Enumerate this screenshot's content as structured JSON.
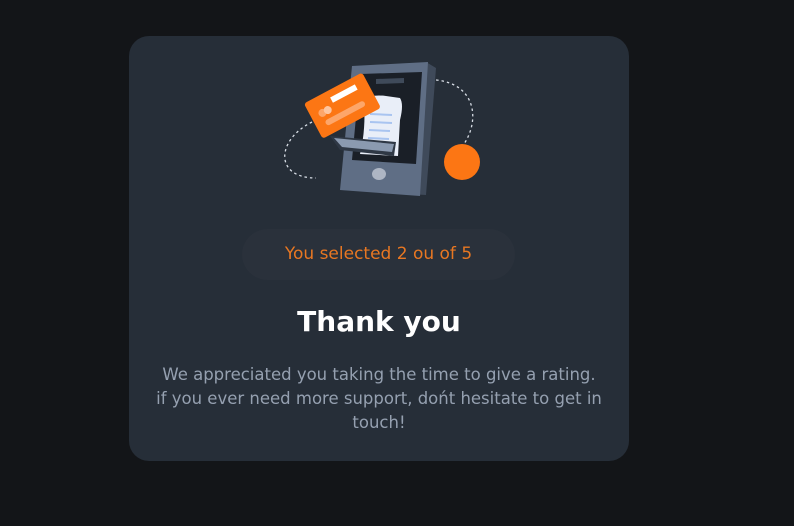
{
  "card": {
    "selection_text": "You selected 2 ou of 5",
    "title": "Thank you",
    "message_lines": [
      "We appreciated you taking the time to give a rating.",
      "if you ever need more support, dońt hesitate to get in",
      "touch!"
    ]
  },
  "colors": {
    "page_bg": "#131518",
    "card_bg": "#262E38",
    "accent_orange": "#FC7614",
    "pill_text": "#E87722",
    "title": "#FFFFFF",
    "body_text": "#95A0B0"
  },
  "icons": {
    "illustration": "phone-with-receipt-and-card-illustration"
  }
}
